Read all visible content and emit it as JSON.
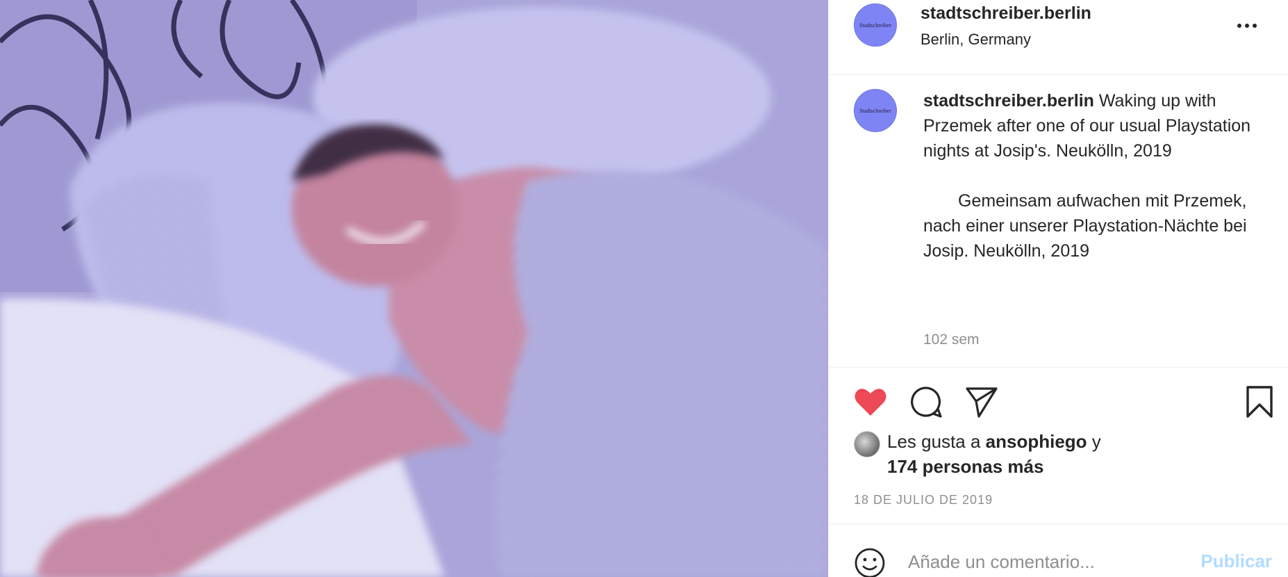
{
  "photo": {
    "alt_subject": "post-photo"
  },
  "header": {
    "avatar_text": "Stadtschreiber",
    "username": "stadtschreiber.berlin",
    "location": "Berlin, Germany"
  },
  "caption": {
    "avatar_text": "Stadtschreiber",
    "username": "stadtschreiber.berlin",
    "text_en": " Waking up with Przemek after one of our usual Playstation nights at Josip's. Neukölln, 2019",
    "text_de": "　　Gemeinsam aufwachen mit Przemek, nach einer unserer Playstation-Nächte bei Josip. Neukölln, 2019",
    "time_ago": "102 sem"
  },
  "actions": {
    "like_icon": "heart-filled-icon",
    "comment_icon": "comment-bubble-icon",
    "share_icon": "paper-plane-icon",
    "save_icon": "bookmark-icon",
    "like_color": "#ed4956"
  },
  "likes": {
    "prefix": "Les gusta a ",
    "user": "ansophiego",
    "connector": " y",
    "others": "174 personas más"
  },
  "date": "18 DE JULIO DE 2019",
  "comment": {
    "placeholder": "Añade un comentario...",
    "publish_label": "Publicar",
    "emoji_icon": "smiley-icon",
    "publish_color": "#b3dbff"
  }
}
